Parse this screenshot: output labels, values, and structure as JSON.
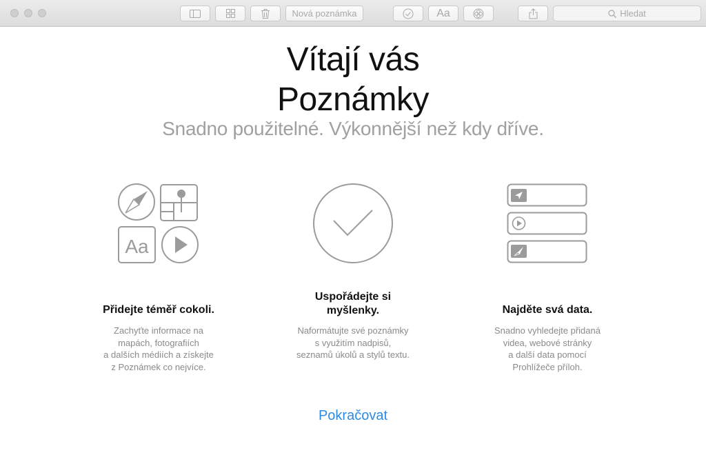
{
  "toolbar": {
    "new_note_label": "Nová poznámka",
    "format_label": "Aa",
    "search_placeholder": "Hledat",
    "icons": [
      "sidebar-icon",
      "grid-icon",
      "trash-icon",
      "checklist-icon",
      "attachment-icon",
      "share-icon",
      "search-icon"
    ]
  },
  "welcome": {
    "title_line1": "Vítají vás",
    "title_line2": "Poznámky",
    "subtitle": "Snadno použitelné. Výkonnější než kdy dříve."
  },
  "features": [
    {
      "icons": [
        "compass-icon",
        "map-pin-icon",
        "text-aa-icon",
        "play-icon"
      ],
      "aa_glyph": "Aa",
      "heading_line1": "Přidejte téměř cokoli.",
      "desc_lines": [
        "Zachyťte informace na",
        "mapách, fotografiích",
        "a dalších médiích a získejte",
        "z Poznámek co nejvíce."
      ]
    },
    {
      "icons": [
        "checkmark-circle-icon"
      ],
      "heading_line1": "Uspořádejte si",
      "heading_line2": "myšlenky.",
      "desc_lines": [
        "Naformátujte své poznámky",
        "s využitím nadpisů,",
        "seznamů úkolů a stylů textu."
      ]
    },
    {
      "icons": [
        "location-arrow-icon",
        "play-circle-icon",
        "compass-needle-icon"
      ],
      "heading_line1": "Najděte svá data.",
      "desc_lines": [
        "Snadno vyhledejte přidaná",
        "videa, webové stránky",
        "a další data pomocí",
        "Prohlížeče příloh."
      ]
    }
  ],
  "continue_label": "Pokračovat",
  "colors": {
    "accent": "#2b8ae6",
    "title": "#111111",
    "subtitle": "#a0a0a0",
    "icon_stroke": "#9b9b9b"
  }
}
